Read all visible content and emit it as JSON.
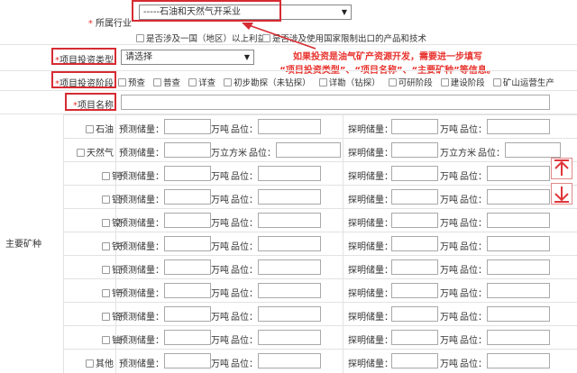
{
  "industry": {
    "label": "所属行业",
    "selected": "-----石油和天然气开采业",
    "option1": "是否涉及一国（地区）以上利益",
    "option2": "是否涉及使用国家限制出口的产品和技术"
  },
  "invest_type": {
    "label": "项目投资类型",
    "selected": "请选择"
  },
  "invest_stage": {
    "label": "项目投资阶段",
    "options": [
      "预查",
      "普查",
      "详查",
      "初步勘探（未钻探）",
      "详勘（钻探）",
      "可研阶段",
      "建设阶段",
      "矿山运营生产"
    ]
  },
  "project_name": {
    "label": "项目名称"
  },
  "annotation": {
    "line1": "如果投资是油气矿产资源开发，需要进一步填写",
    "line2": "“项目投资类型”、“项目名称”、“主要矿种”等信息。"
  },
  "minerals": {
    "section_label": "主要矿种",
    "predict_label": "预测储量：",
    "proven_label": "探明储量：",
    "grade_label": "品位：",
    "rows": [
      {
        "name": "石油",
        "unit": "万吨"
      },
      {
        "name": "天然气",
        "unit": "万立方米"
      },
      {
        "name": "铜",
        "unit": "万吨"
      },
      {
        "name": "铝",
        "unit": "万吨"
      },
      {
        "name": "镍",
        "unit": "万吨"
      },
      {
        "name": "铁",
        "unit": "万吨"
      },
      {
        "name": "铅",
        "unit": "万吨"
      },
      {
        "name": "锌",
        "unit": "万吨"
      },
      {
        "name": "铬",
        "unit": "万吨"
      },
      {
        "name": "铀",
        "unit": "万吨"
      },
      {
        "name": "其他",
        "unit": "万吨"
      }
    ]
  },
  "icons": {
    "up": "arrow-up-icon",
    "down": "arrow-down-icon"
  },
  "colors": {
    "accent_red": "#d62b32",
    "annotation_red": "#e8322d"
  }
}
